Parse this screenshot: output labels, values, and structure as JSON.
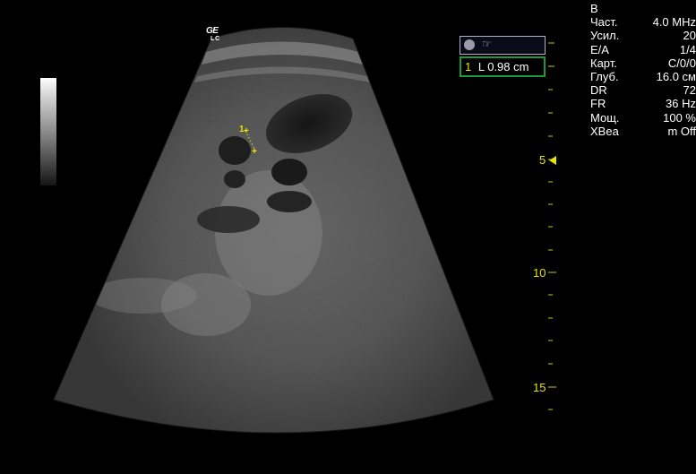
{
  "logo": {
    "brand": "GE",
    "sub": "L C"
  },
  "mode": "B",
  "params": [
    {
      "label": "Част.",
      "value": "4.0 MHz"
    },
    {
      "label": "Усил.",
      "value": "20"
    },
    {
      "label": "E/A",
      "value": "1/4"
    },
    {
      "label": "Карт.",
      "value": "C/0/0"
    },
    {
      "label": "Глуб.",
      "value": "16.0 см"
    },
    {
      "label": "DR",
      "value": "72"
    },
    {
      "label": "FR",
      "value": "36 Hz"
    },
    {
      "label": "Мощ.",
      "value": "100 %"
    },
    {
      "label": "XBea",
      "value": "m Off"
    }
  ],
  "measurement": {
    "index": "1",
    "text": "L  0.98 cm"
  },
  "depth_scale": {
    "labels": [
      "5",
      "10",
      "15"
    ],
    "focus_depth": 5
  },
  "caliper": {
    "label": "1",
    "marker": "+"
  },
  "colors": {
    "annotation": "#e6e600",
    "measure_border": "#1e9a3c"
  }
}
